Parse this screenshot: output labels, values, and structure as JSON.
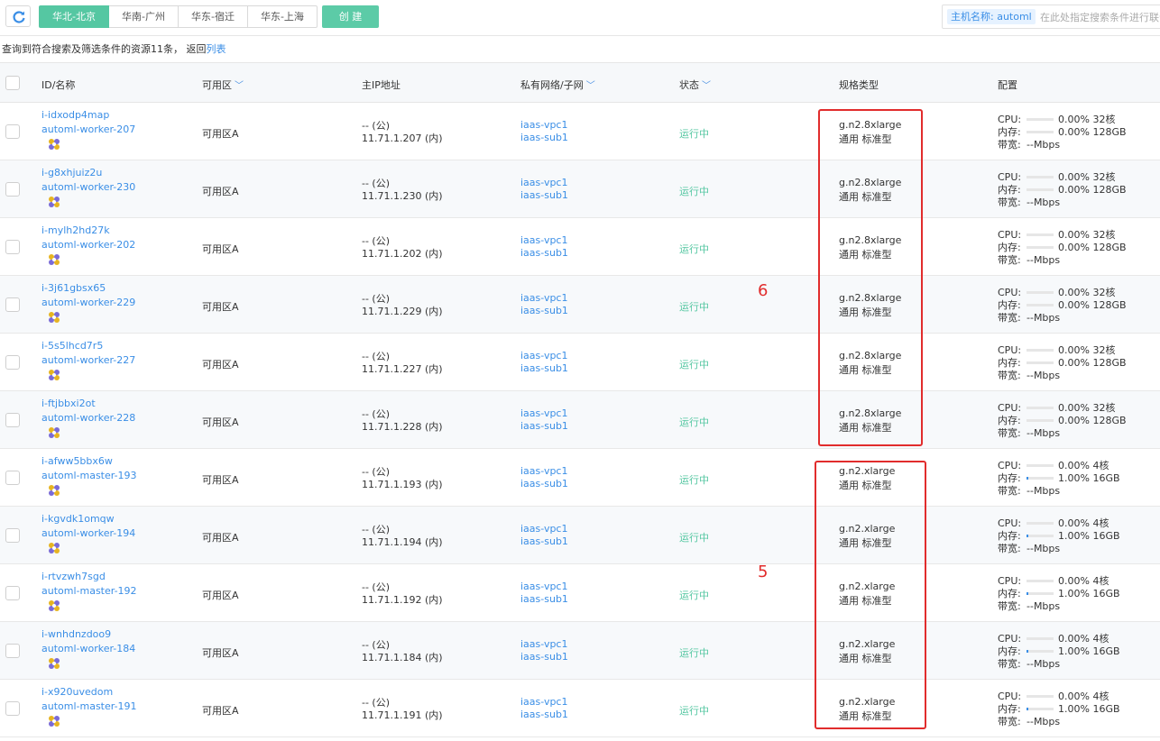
{
  "toolbar": {
    "regions": [
      "华北-北京",
      "华南-广州",
      "华东-宿迁",
      "华东-上海"
    ],
    "create_label": "创 建",
    "search_tag": "主机名称: automl",
    "search_placeholder": "在此处指定搜索条件进行联合搜索"
  },
  "summary": {
    "text": "查询到符合搜索及筛选条件的资源11条，  返回",
    "link": "列表"
  },
  "columns": [
    "ID/名称",
    "可用区",
    "主IP地址",
    "私有网络/子网",
    "状态",
    "规格类型",
    "配置"
  ],
  "rows": [
    {
      "id": "i-idxodp4map",
      "name": "automl-worker-207",
      "zone": "可用区A",
      "ip_pub": "-- (公)",
      "ip_priv": "11.71.1.207 (内)",
      "vpc": "iaas-vpc1",
      "subnet": "iaas-sub1",
      "status": "运行中",
      "spec": "g.n2.8xlarge",
      "spec_type": "通用 标准型",
      "cpu_pct": "0.00%",
      "cpu": "32核",
      "mem_pct": "0.00%",
      "mem": "128GB",
      "mem_fill": 0,
      "bw": "--Mbps"
    },
    {
      "id": "i-g8xhjuiz2u",
      "name": "automl-worker-230",
      "zone": "可用区A",
      "ip_pub": "-- (公)",
      "ip_priv": "11.71.1.230 (内)",
      "vpc": "iaas-vpc1",
      "subnet": "iaas-sub1",
      "status": "运行中",
      "spec": "g.n2.8xlarge",
      "spec_type": "通用 标准型",
      "cpu_pct": "0.00%",
      "cpu": "32核",
      "mem_pct": "0.00%",
      "mem": "128GB",
      "mem_fill": 0,
      "bw": "--Mbps"
    },
    {
      "id": "i-mylh2hd27k",
      "name": "automl-worker-202",
      "zone": "可用区A",
      "ip_pub": "-- (公)",
      "ip_priv": "11.71.1.202 (内)",
      "vpc": "iaas-vpc1",
      "subnet": "iaas-sub1",
      "status": "运行中",
      "spec": "g.n2.8xlarge",
      "spec_type": "通用 标准型",
      "cpu_pct": "0.00%",
      "cpu": "32核",
      "mem_pct": "0.00%",
      "mem": "128GB",
      "mem_fill": 0,
      "bw": "--Mbps"
    },
    {
      "id": "i-3j61gbsx65",
      "name": "automl-worker-229",
      "zone": "可用区A",
      "ip_pub": "-- (公)",
      "ip_priv": "11.71.1.229 (内)",
      "vpc": "iaas-vpc1",
      "subnet": "iaas-sub1",
      "status": "运行中",
      "spec": "g.n2.8xlarge",
      "spec_type": "通用 标准型",
      "cpu_pct": "0.00%",
      "cpu": "32核",
      "mem_pct": "0.00%",
      "mem": "128GB",
      "mem_fill": 0,
      "bw": "--Mbps"
    },
    {
      "id": "i-5s5lhcd7r5",
      "name": "automl-worker-227",
      "zone": "可用区A",
      "ip_pub": "-- (公)",
      "ip_priv": "11.71.1.227 (内)",
      "vpc": "iaas-vpc1",
      "subnet": "iaas-sub1",
      "status": "运行中",
      "spec": "g.n2.8xlarge",
      "spec_type": "通用 标准型",
      "cpu_pct": "0.00%",
      "cpu": "32核",
      "mem_pct": "0.00%",
      "mem": "128GB",
      "mem_fill": 0,
      "bw": "--Mbps"
    },
    {
      "id": "i-ftjbbxi2ot",
      "name": "automl-worker-228",
      "zone": "可用区A",
      "ip_pub": "-- (公)",
      "ip_priv": "11.71.1.228 (内)",
      "vpc": "iaas-vpc1",
      "subnet": "iaas-sub1",
      "status": "运行中",
      "spec": "g.n2.8xlarge",
      "spec_type": "通用 标准型",
      "cpu_pct": "0.00%",
      "cpu": "32核",
      "mem_pct": "0.00%",
      "mem": "128GB",
      "mem_fill": 0,
      "bw": "--Mbps"
    },
    {
      "id": "i-afww5bbx6w",
      "name": "automl-master-193",
      "zone": "可用区A",
      "ip_pub": "-- (公)",
      "ip_priv": "11.71.1.193 (内)",
      "vpc": "iaas-vpc1",
      "subnet": "iaas-sub1",
      "status": "运行中",
      "spec": "g.n2.xlarge",
      "spec_type": "通用 标准型",
      "cpu_pct": "0.00%",
      "cpu": "4核",
      "mem_pct": "1.00%",
      "mem": "16GB",
      "mem_fill": 0.01,
      "bw": "--Mbps"
    },
    {
      "id": "i-kgvdk1omqw",
      "name": "automl-worker-194",
      "zone": "可用区A",
      "ip_pub": "-- (公)",
      "ip_priv": "11.71.1.194 (内)",
      "vpc": "iaas-vpc1",
      "subnet": "iaas-sub1",
      "status": "运行中",
      "spec": "g.n2.xlarge",
      "spec_type": "通用 标准型",
      "cpu_pct": "0.00%",
      "cpu": "4核",
      "mem_pct": "1.00%",
      "mem": "16GB",
      "mem_fill": 0.01,
      "bw": "--Mbps"
    },
    {
      "id": "i-rtvzwh7sgd",
      "name": "automl-master-192",
      "zone": "可用区A",
      "ip_pub": "-- (公)",
      "ip_priv": "11.71.1.192 (内)",
      "vpc": "iaas-vpc1",
      "subnet": "iaas-sub1",
      "status": "运行中",
      "spec": "g.n2.xlarge",
      "spec_type": "通用 标准型",
      "cpu_pct": "0.00%",
      "cpu": "4核",
      "mem_pct": "1.00%",
      "mem": "16GB",
      "mem_fill": 0.01,
      "bw": "--Mbps"
    },
    {
      "id": "i-wnhdnzdoo9",
      "name": "automl-worker-184",
      "zone": "可用区A",
      "ip_pub": "-- (公)",
      "ip_priv": "11.71.1.184 (内)",
      "vpc": "iaas-vpc1",
      "subnet": "iaas-sub1",
      "status": "运行中",
      "spec": "g.n2.xlarge",
      "spec_type": "通用 标准型",
      "cpu_pct": "0.00%",
      "cpu": "4核",
      "mem_pct": "1.00%",
      "mem": "16GB",
      "mem_fill": 0.01,
      "bw": "--Mbps"
    },
    {
      "id": "i-x920uvedom",
      "name": "automl-master-191",
      "zone": "可用区A",
      "ip_pub": "-- (公)",
      "ip_priv": "11.71.1.191 (内)",
      "vpc": "iaas-vpc1",
      "subnet": "iaas-sub1",
      "status": "运行中",
      "spec": "g.n2.xlarge",
      "spec_type": "通用 标准型",
      "cpu_pct": "0.00%",
      "cpu": "4核",
      "mem_pct": "1.00%",
      "mem": "16GB",
      "mem_fill": 0.01,
      "bw": "--Mbps"
    }
  ],
  "cfg_labels": {
    "cpu": "CPU:",
    "mem": "内存:",
    "bw": "带宽:"
  },
  "annotations": [
    "6",
    "5"
  ],
  "colors": {
    "accent": "#55c7a2",
    "link": "#3a8ee6",
    "annotation": "#e12c2c"
  }
}
